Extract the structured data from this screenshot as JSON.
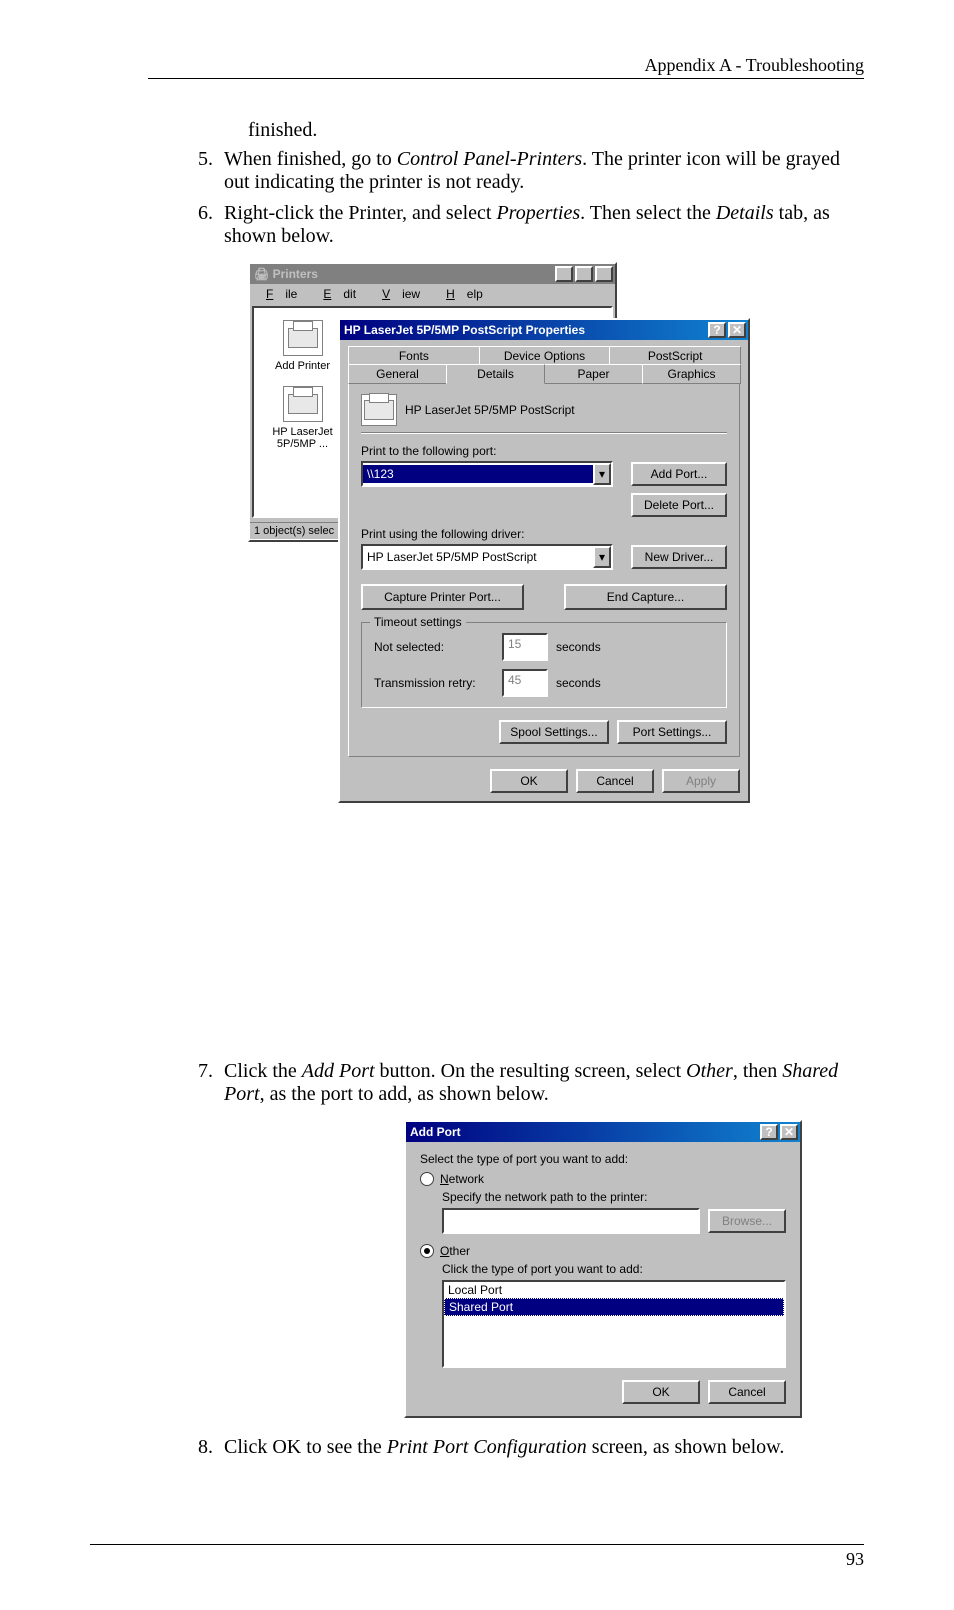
{
  "header": "Appendix A - Troubleshooting",
  "page_number": "93",
  "continued_text": "finished.",
  "steps": {
    "s5": {
      "num": "5",
      "pre": "When finished, go to ",
      "em": "Control Panel-Printers",
      "post": ". The printer icon will be grayed out indicating the printer is not ready."
    },
    "s6": {
      "num": "6",
      "pre": "Right-click the Printer, and select ",
      "em1": "Properties",
      "mid": ". Then select the ",
      "em2": "Details",
      "post": " tab, as shown below."
    },
    "s7": {
      "num": "7",
      "pre": "Click the ",
      "em1": "Add Port",
      "mid": " button. On the resulting screen, select ",
      "em2": "Other",
      "mid2": ", then ",
      "em3": "Shared Port",
      "post": ", as the port to add, as shown below."
    },
    "s8": {
      "num": "8",
      "pre": "Click OK to see the ",
      "em": "Print Port Configuration",
      "post": " screen, as shown below."
    }
  },
  "fig1": {
    "printers_title": "Printers",
    "menu": {
      "file": "File",
      "edit": "Edit",
      "view": "View",
      "help": "Help"
    },
    "add_printer": "Add Printer",
    "printer_name": "HP LaserJet 5P/5MP ...",
    "status": "1 object(s) selec",
    "props_title": "HP LaserJet 5P/5MP PostScript Properties",
    "tabs": {
      "fonts": "Fonts",
      "device": "Device Options",
      "postscript": "PostScript",
      "general": "General",
      "details": "Details",
      "paper": "Paper",
      "graphics": "Graphics"
    },
    "device_line": "HP LaserJet 5P/5MP PostScript",
    "port_label": "Print to the following port:",
    "port_value": "\\\\123",
    "driver_label": "Print using the following driver:",
    "driver_value": "HP LaserJet 5P/5MP PostScript",
    "btn": {
      "add_port": "Add Port...",
      "delete_port": "Delete Port...",
      "new_driver": "New Driver...",
      "capture": "Capture Printer Port...",
      "end_capture": "End Capture...",
      "spool": "Spool Settings...",
      "port_settings": "Port Settings...",
      "ok": "OK",
      "cancel": "Cancel",
      "apply": "Apply"
    },
    "timeout": {
      "legend": "Timeout settings",
      "not_selected": "Not selected:",
      "not_selected_val": "15",
      "retry": "Transmission retry:",
      "retry_val": "45",
      "seconds": "seconds"
    }
  },
  "fig2": {
    "title": "Add Port",
    "intro": "Select the type of port you want to add:",
    "network": "Network",
    "network_hint": "Specify the network path to the printer:",
    "browse": "Browse...",
    "other": "Other",
    "other_hint": "Click the type of port you want to add:",
    "items": {
      "local": "Local Port",
      "shared": "Shared Port"
    },
    "ok": "OK",
    "cancel": "Cancel"
  }
}
